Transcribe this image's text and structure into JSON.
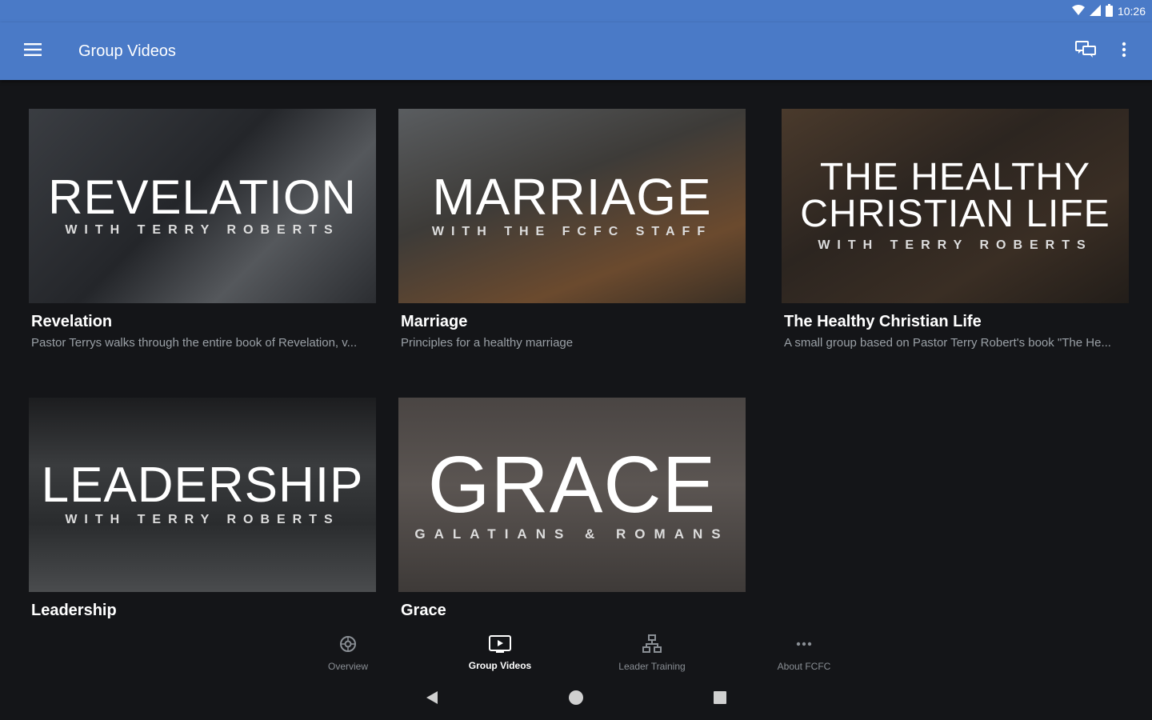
{
  "status": {
    "time": "10:26"
  },
  "appbar": {
    "title": "Group Videos"
  },
  "cards": [
    {
      "title": "Revelation",
      "subtitle": "Pastor Terrys walks through the entire book of Revelation, v...",
      "thumb_big": "REVELATION",
      "thumb_small": "WITH TERRY ROBERTS"
    },
    {
      "title": "Marriage",
      "subtitle": "Principles for a healthy marriage",
      "thumb_big": "MARRIAGE",
      "thumb_small": "WITH THE FCFC STAFF"
    },
    {
      "title": "The Healthy Christian Life",
      "subtitle": "A small group based on Pastor Terry Robert's book \"The He...",
      "thumb_big_1": "THE HEALTHY",
      "thumb_big_2": "CHRISTIAN LIFE",
      "thumb_small": "WITH TERRY ROBERTS"
    },
    {
      "title": "Leadership",
      "subtitle": "",
      "thumb_big": "LEADERSHIP",
      "thumb_small": "WITH TERRY ROBERTS"
    },
    {
      "title": "Grace",
      "subtitle": "",
      "thumb_big": "GRACE",
      "thumb_small": "GALATIANS & ROMANS"
    }
  ],
  "bottom_nav": [
    {
      "label": "Overview",
      "icon": "overview-icon",
      "active": false
    },
    {
      "label": "Group Videos",
      "icon": "video-icon",
      "active": true
    },
    {
      "label": "Leader Training",
      "icon": "org-chart-icon",
      "active": false
    },
    {
      "label": "About FCFC",
      "icon": "more-horiz-icon",
      "active": false
    }
  ],
  "colors": {
    "appbar": "#4a7ac7",
    "background": "#141518",
    "subtitle": "#9aa0a6"
  }
}
